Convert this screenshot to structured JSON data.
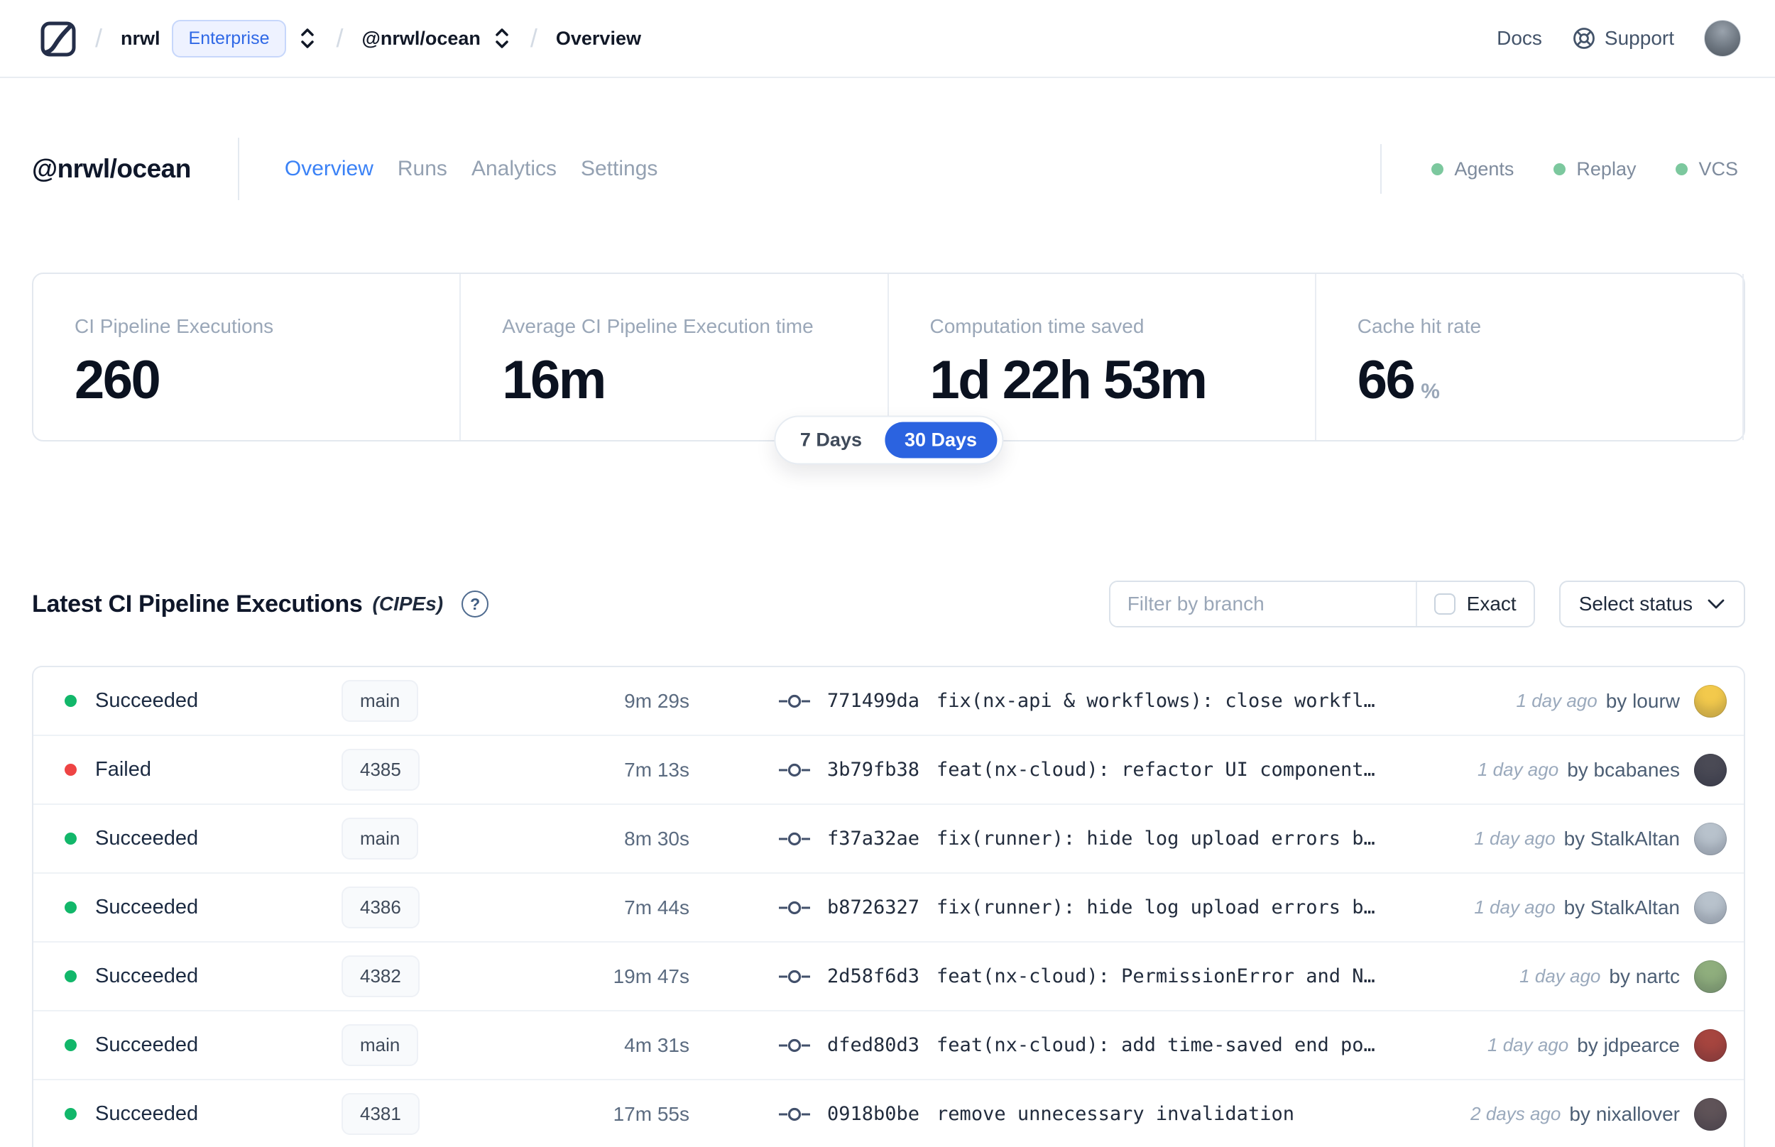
{
  "header": {
    "breadcrumb": {
      "org": "nrwl",
      "org_badge": "Enterprise",
      "workspace": "@nrwl/ocean",
      "page": "Overview"
    },
    "links": {
      "docs": "Docs",
      "support": "Support"
    }
  },
  "workspace": {
    "title": "@nrwl/ocean",
    "tabs": [
      {
        "label": "Overview",
        "active": true
      },
      {
        "label": "Runs",
        "active": false
      },
      {
        "label": "Analytics",
        "active": false
      },
      {
        "label": "Settings",
        "active": false
      }
    ],
    "integrations": [
      "Agents",
      "Replay",
      "VCS"
    ]
  },
  "stats": {
    "cards": [
      {
        "label": "CI Pipeline Executions",
        "value": "260",
        "suffix": ""
      },
      {
        "label": "Average CI Pipeline Execution time",
        "value": "16m",
        "suffix": ""
      },
      {
        "label": "Computation time saved",
        "value": "1d 22h 53m",
        "suffix": ""
      },
      {
        "label": "Cache hit rate",
        "value": "66",
        "suffix": "%"
      }
    ],
    "range_toggle": {
      "options": [
        "7 Days",
        "30 Days"
      ],
      "selected": "30 Days"
    }
  },
  "cipes": {
    "title": "Latest CI Pipeline Executions",
    "title_suffix": "(CIPEs)",
    "help_glyph": "?",
    "filter": {
      "branch_placeholder": "Filter by branch",
      "exact_label": "Exact",
      "exact_checked": false,
      "status_label": "Select status"
    },
    "rows": [
      {
        "status": "Succeeded",
        "status_color": "green",
        "branch": "main",
        "duration": "9m 29s",
        "commit_hash": "771499da",
        "commit_message": "fix(nx-api & workflows): close workfl…",
        "time": "1 day ago",
        "author": "by lourw",
        "avatar_color": "#f2c94c"
      },
      {
        "status": "Failed",
        "status_color": "red",
        "branch": "4385",
        "duration": "7m 13s",
        "commit_hash": "3b79fb38",
        "commit_message": "feat(nx-cloud): refactor UI component…",
        "time": "1 day ago",
        "author": "by bcabanes",
        "avatar_color": "#4a4a55"
      },
      {
        "status": "Succeeded",
        "status_color": "green",
        "branch": "main",
        "duration": "8m 30s",
        "commit_hash": "f37a32ae",
        "commit_message": "fix(runner): hide log upload errors b…",
        "time": "1 day ago",
        "author": "by StalkAltan",
        "avatar_color": "#b8c2cc"
      },
      {
        "status": "Succeeded",
        "status_color": "green",
        "branch": "4386",
        "duration": "7m 44s",
        "commit_hash": "b8726327",
        "commit_message": "fix(runner): hide log upload errors b…",
        "time": "1 day ago",
        "author": "by StalkAltan",
        "avatar_color": "#b8c2cc"
      },
      {
        "status": "Succeeded",
        "status_color": "green",
        "branch": "4382",
        "duration": "19m 47s",
        "commit_hash": "2d58f6d3",
        "commit_message": "feat(nx-cloud): PermissionError and N…",
        "time": "1 day ago",
        "author": "by nartc",
        "avatar_color": "#8fae7d"
      },
      {
        "status": "Succeeded",
        "status_color": "green",
        "branch": "main",
        "duration": "4m 31s",
        "commit_hash": "dfed80d3",
        "commit_message": "feat(nx-cloud): add time-saved end po…",
        "time": "1 day ago",
        "author": "by jdpearce",
        "avatar_color": "#a6453f"
      },
      {
        "status": "Succeeded",
        "status_color": "green",
        "branch": "4381",
        "duration": "17m 55s",
        "commit_hash": "0918b0be",
        "commit_message": "remove unnecessary invalidation",
        "time": "2 days ago",
        "author": "by nixallover",
        "avatar_color": "#5f5358"
      }
    ]
  },
  "colors": {
    "accent_blue": "#2b63e0",
    "tab_active_blue": "#3b82f6",
    "success_green": "#12b76a",
    "failed_red": "#ee4444",
    "integration_dot_green": "#7cc89e",
    "enterprise_badge_bg": "#eef2ff",
    "enterprise_badge_text": "#2f68e6"
  }
}
